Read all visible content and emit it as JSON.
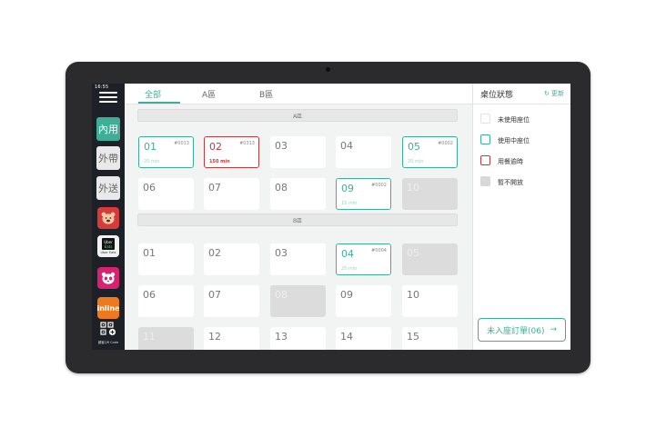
{
  "status_bar": {
    "time": "16:55"
  },
  "sidebar": {
    "dine_in": "內用",
    "takeout": "外帶",
    "delivery": "外送",
    "uber_line1": "Uber",
    "uber_line2": "Eats",
    "uber_label": "Uber Eats",
    "inline": "inline",
    "qr_label": "顧客QR Code"
  },
  "tabs": [
    "全部",
    "A區",
    "B區"
  ],
  "zones": {
    "a": {
      "label": "A區",
      "tables": [
        {
          "num": "01",
          "order": "#0013",
          "time": "20 min",
          "status": "inuse"
        },
        {
          "num": "02",
          "order": "#0313",
          "time": "150 min",
          "status": "overdue"
        },
        {
          "num": "03",
          "order": "",
          "time": "",
          "status": "unused"
        },
        {
          "num": "04",
          "order": "",
          "time": "",
          "status": "unused"
        },
        {
          "num": "05",
          "order": "#0002",
          "time": "20 min",
          "status": "inuse"
        },
        {
          "num": "06",
          "order": "",
          "time": "",
          "status": "unused"
        },
        {
          "num": "07",
          "order": "",
          "time": "",
          "status": "unused"
        },
        {
          "num": "08",
          "order": "",
          "time": "",
          "status": "unused"
        },
        {
          "num": "09",
          "order": "#0002",
          "time": "15 min",
          "status": "inuse"
        },
        {
          "num": "10",
          "order": "",
          "time": "",
          "status": "closed"
        }
      ]
    },
    "b": {
      "label": "B區",
      "tables": [
        {
          "num": "01",
          "order": "",
          "time": "",
          "status": "unused"
        },
        {
          "num": "02",
          "order": "",
          "time": "",
          "status": "unused"
        },
        {
          "num": "03",
          "order": "",
          "time": "",
          "status": "unused"
        },
        {
          "num": "04",
          "order": "#0004",
          "time": "25 min",
          "status": "inuse"
        },
        {
          "num": "05",
          "order": "",
          "time": "",
          "status": "closed"
        },
        {
          "num": "06",
          "order": "",
          "time": "",
          "status": "unused"
        },
        {
          "num": "07",
          "order": "",
          "time": "",
          "status": "unused"
        },
        {
          "num": "08",
          "order": "",
          "time": "",
          "status": "closed"
        },
        {
          "num": "09",
          "order": "",
          "time": "",
          "status": "unused"
        },
        {
          "num": "10",
          "order": "",
          "time": "",
          "status": "unused"
        },
        {
          "num": "11",
          "order": "",
          "time": "",
          "status": "closed"
        },
        {
          "num": "12",
          "order": "",
          "time": "",
          "status": "unused"
        },
        {
          "num": "13",
          "order": "",
          "time": "",
          "status": "unused"
        },
        {
          "num": "14",
          "order": "",
          "time": "",
          "status": "unused"
        },
        {
          "num": "15",
          "order": "",
          "time": "",
          "status": "unused"
        }
      ]
    }
  },
  "panel": {
    "title": "桌位狀態",
    "refresh": "更新",
    "legend": [
      {
        "status": "unused",
        "label": "未使用座位"
      },
      {
        "status": "inuse",
        "label": "使用中座位"
      },
      {
        "status": "overdue",
        "label": "用餐逾時"
      },
      {
        "status": "closed",
        "label": "暫不開放"
      }
    ],
    "pending_button": "未入座訂單(06)"
  },
  "colors": {
    "accent": "#3fae96",
    "overdue": "#c23b3b",
    "closed": "#dcdcdc",
    "rail": "#1d2026"
  }
}
